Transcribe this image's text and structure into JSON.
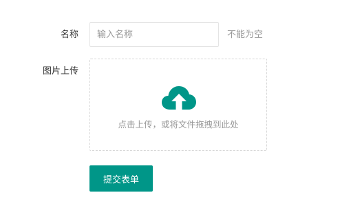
{
  "form": {
    "name_label": "名称",
    "name_placeholder": "输入名称",
    "name_value": "",
    "name_hint": "不能为空",
    "upload_label": "图片上传",
    "upload_text": "点击上传，或将文件拖拽到此处",
    "upload_icon": "cloud-upload-icon",
    "submit_label": "提交表单"
  },
  "colors": {
    "accent": "#009688",
    "text": "#333333",
    "muted": "#999999",
    "border": "#e4e4e4"
  }
}
